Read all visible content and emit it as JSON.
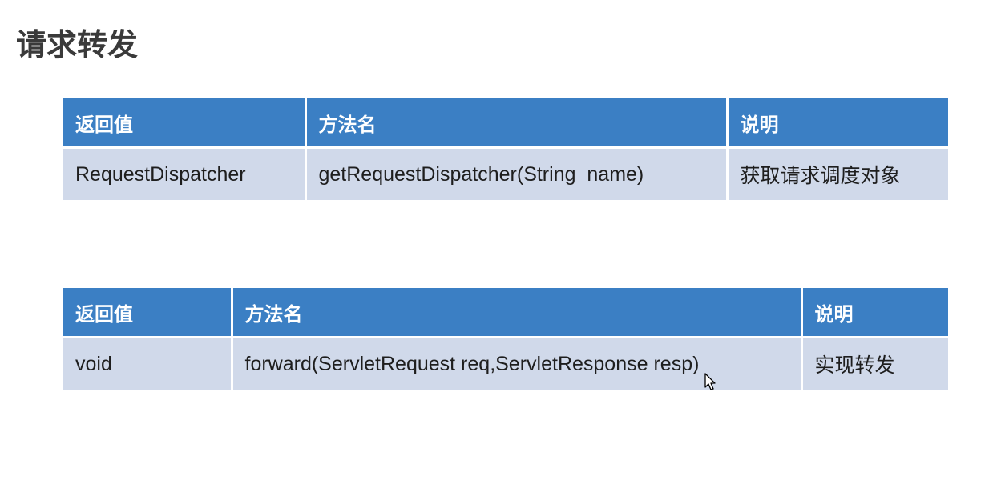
{
  "slide": {
    "title": "请求转发"
  },
  "tables": [
    {
      "headers": [
        "返回值",
        "方法名",
        "说明"
      ],
      "rows": [
        [
          "RequestDispatcher",
          "getRequestDispatcher(String  name)",
          "获取请求调度对象"
        ]
      ]
    },
    {
      "headers": [
        "返回值",
        "方法名",
        "说明"
      ],
      "rows": [
        [
          "void",
          "forward(ServletRequest req,ServletResponse resp)",
          "实现转发"
        ]
      ]
    }
  ],
  "colors": {
    "header_bg": "#3b7fc4",
    "row_bg": "#d0d9ea",
    "title_text": "#3a3a3a"
  },
  "icons": [
    "mouse-pointer-icon"
  ]
}
